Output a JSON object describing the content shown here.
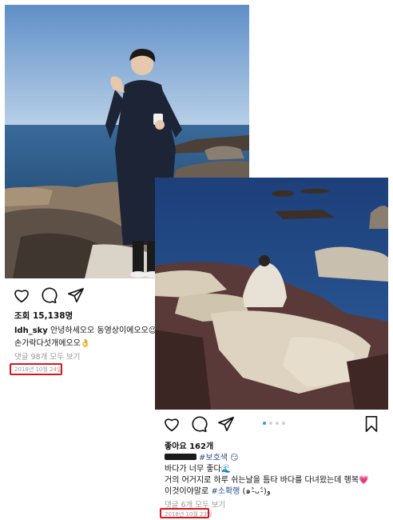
{
  "post_a": {
    "views_label": "조회 15,138명",
    "username": "ldh_sky",
    "caption_line1": " 안녕하세오오 동영상이에오오😉",
    "caption_line2": "손가락다섯개에오오👌",
    "comments_link": "댓글 98개 모두 보기",
    "date": "2018년 10월 24일"
  },
  "post_b": {
    "likes_label": "좋아요 162개",
    "tag_line": "#보호색 😏",
    "caption_line1": "바다가 너무 좋다🌊",
    "caption_line2": "거의 어거지로 하루 쉬는날을 틈타 바다를 다녀왔는데 행복💗",
    "caption_line3_text": "이것이야말로 ",
    "caption_line3_tag": "#소확행",
    "caption_line3_end": " (๑˃̵ᴗ˂̵)و",
    "comments_link": "댓글 6개 모두 보기",
    "date": "2018년 10월 23일",
    "carousel_active_index": 1,
    "carousel_count": 4
  },
  "colors": {
    "highlight": "#e0141e",
    "link_blue": "#2a4f8f",
    "carousel_active": "#3797f0",
    "muted": "#999999"
  },
  "icons": [
    "heart-icon",
    "comment-icon",
    "share-icon",
    "bookmark-icon"
  ]
}
